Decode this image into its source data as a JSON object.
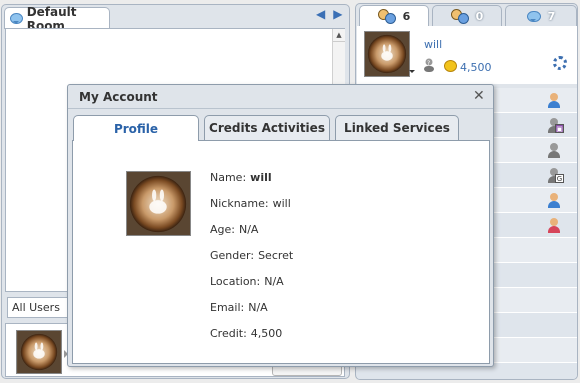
{
  "room": {
    "tab_label": "Default Room",
    "users_filter": "All Users"
  },
  "right_tabs": [
    {
      "count": "6"
    },
    {
      "count": "0"
    },
    {
      "count": "7"
    }
  ],
  "me": {
    "name": "will",
    "credits": "4,500"
  },
  "dialog": {
    "title": "My Account",
    "tabs": [
      "Profile",
      "Credits Activities",
      "Linked Services"
    ],
    "fields": [
      {
        "label": "Name:",
        "value": "will"
      },
      {
        "label": "Nickname:",
        "value": "will"
      },
      {
        "label": "Age:",
        "value": "N/A"
      },
      {
        "label": "Gender:",
        "value": "Secret"
      },
      {
        "label": "Location:",
        "value": "N/A"
      },
      {
        "label": "Email:",
        "value": "N/A"
      },
      {
        "label": "Credit:",
        "value": "4,500"
      }
    ]
  },
  "user_list_icons": [
    "male-user-icon",
    "cam-user-icon",
    "unknown-user-icon",
    "guest-user-icon",
    "male-user-icon",
    "female-user-icon"
  ],
  "colors": {
    "accent": "#2a62a8",
    "male": "#3b7fd0",
    "female": "#d6455a",
    "unknown": "#8a8a8a"
  }
}
